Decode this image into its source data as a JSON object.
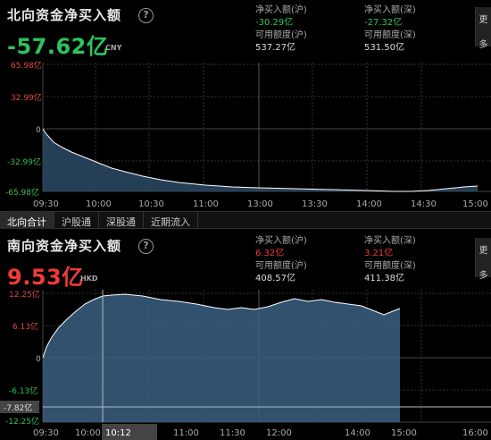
{
  "north": {
    "title": "北向资金净买入额",
    "value": "-57.62亿",
    "currency": "CNY",
    "stats": [
      {
        "label": "净买入额(沪)",
        "value": "-30.29亿"
      },
      {
        "label": "净买入额(深)",
        "value": "-27.32亿"
      },
      {
        "label": "可用额度(沪)",
        "value": "537.27亿"
      },
      {
        "label": "可用额度(深)",
        "value": "531.50亿"
      }
    ],
    "more_label": "更多",
    "y_ticks": [
      "65.98亿",
      "32.99亿",
      "0",
      "-32.99亿",
      "-65.98亿"
    ],
    "x_ticks": [
      "09:30",
      "10:00",
      "10:30",
      "11:00",
      "13:00",
      "13:30",
      "14:00",
      "14:30",
      "15:00"
    ]
  },
  "tabs": [
    "北向合计",
    "沪股通",
    "深股通",
    "近期流入"
  ],
  "south": {
    "title": "南向资金净买入额",
    "value": "9.53亿",
    "currency": "HKD",
    "stats": [
      {
        "label": "净买入额(沪)",
        "value": "6.32亿"
      },
      {
        "label": "净买入额(深)",
        "value": "3.21亿"
      },
      {
        "label": "可用额度(沪)",
        "value": "408.57亿"
      },
      {
        "label": "可用额度(深)",
        "value": "411.38亿"
      }
    ],
    "more_label": "更多",
    "y_ticks": [
      "12.25亿",
      "6.13亿",
      "0",
      "-6.13亿",
      "-12.25亿"
    ],
    "x_ticks": [
      "09:30",
      "10:00",
      "10:12",
      "11:00",
      "11:30",
      "12:00",
      "14:00",
      "15:00",
      "16:00"
    ],
    "crosshair_value": "-7.82亿",
    "crosshair_time": "10:12"
  },
  "chart_data": [
    {
      "type": "area",
      "title": "北向资金净买入额",
      "x": [
        "09:30",
        "10:00",
        "10:30",
        "11:00",
        "13:00",
        "13:30",
        "14:00",
        "14:30",
        "15:00"
      ],
      "series": [
        {
          "values": [
            0,
            -25,
            -42,
            -50,
            -57,
            -61,
            -64,
            -66,
            -63,
            -57.62
          ]
        }
      ],
      "ylim": [
        -65.98,
        65.98
      ]
    },
    {
      "type": "area",
      "title": "南向资金净买入额",
      "x": [
        "09:30",
        "10:00",
        "10:30",
        "11:00",
        "11:30",
        "12:00",
        "14:00",
        "15:00",
        "16:00"
      ],
      "series": [
        {
          "values": [
            0,
            6,
            11.5,
            12.2,
            11.5,
            10,
            10.8,
            10.2,
            11.8,
            10.5,
            9.53
          ]
        }
      ],
      "ylim": [
        -12.25,
        12.25
      ]
    }
  ],
  "colors": {
    "grid": "#333333",
    "line": "#ffffff",
    "fill": "#2f4f6b"
  }
}
